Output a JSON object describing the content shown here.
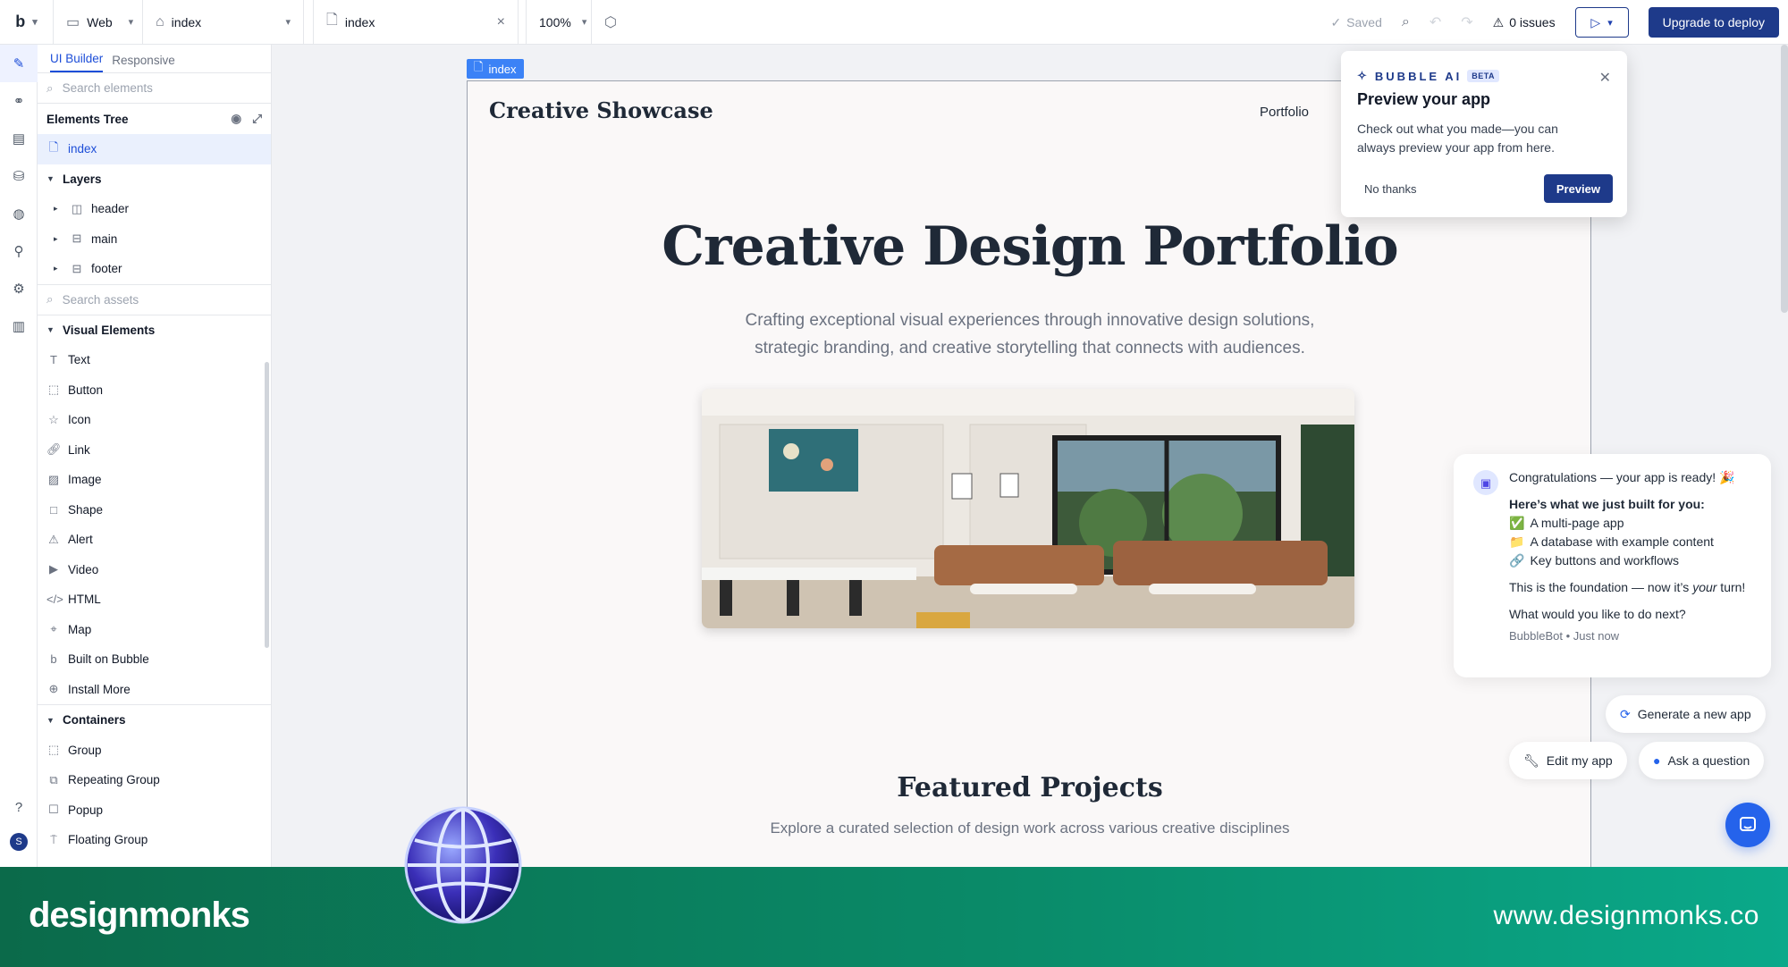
{
  "topbar": {
    "logo": "b",
    "platform": "Web",
    "page_select": "index",
    "open_tab": "index",
    "zoom": "100%",
    "saved": "Saved",
    "issues": "0 issues",
    "deploy_label": "Upgrade to deploy"
  },
  "rail": {
    "avatar_letter": "S"
  },
  "panel": {
    "tabs": [
      "UI Builder",
      "Responsive"
    ],
    "search_elements_placeholder": "Search elements",
    "tree_title": "Elements Tree",
    "tree_root": "index",
    "layers_label": "Layers",
    "layers": [
      "header",
      "main",
      "footer"
    ],
    "search_assets_placeholder": "Search assets",
    "visual_label": "Visual Elements",
    "visual": [
      "Text",
      "Button",
      "Icon",
      "Link",
      "Image",
      "Shape",
      "Alert",
      "Video",
      "HTML",
      "Map",
      "Built on Bubble",
      "Install More"
    ],
    "containers_label": "Containers",
    "containers": [
      "Group",
      "Repeating Group",
      "Popup",
      "Floating Group"
    ]
  },
  "canvas": {
    "page_label": "index",
    "brand": "Creative Showcase",
    "nav_link": "Portfolio",
    "hero_title": "Creative Design Portfolio",
    "hero_sub": "Crafting exceptional visual experiences through innovative design solutions, strategic branding, and creative storytelling that connects with audiences.",
    "featured_title": "Featured Projects",
    "featured_sub": "Explore a curated selection of design work across various creative disciplines"
  },
  "popover": {
    "brand": "BUBBLE AI",
    "badge": "BETA",
    "title": "Preview your app",
    "text": "Check out what you made—you can always preview your app from here.",
    "dismiss": "No thanks",
    "action": "Preview"
  },
  "chat": {
    "greeting": "Congratulations — your app is ready! 🎉",
    "built_heading": "Here’s what we just built for you:",
    "built_items": [
      {
        "emoji": "✅",
        "text": "A multi-page app"
      },
      {
        "emoji": "📁",
        "text": "A database with example content"
      },
      {
        "emoji": "🔗",
        "text": "Key buttons and workflows"
      }
    ],
    "foundation_pre": "This is the foundation — now it’s ",
    "foundation_em": "your",
    "foundation_post": " turn!",
    "question": "What would you like to do next?",
    "meta": "BubbleBot • Just now",
    "chips": [
      "Generate a new app",
      "Edit my app",
      "Ask a question"
    ]
  },
  "banner": {
    "logo": "designmonks",
    "url": "www.designmonks.co"
  },
  "colors": {
    "accent": "#1e3a8a",
    "selection": "#3b82f6",
    "banner_start": "#0b6a4a",
    "banner_end": "#0aa98a"
  }
}
